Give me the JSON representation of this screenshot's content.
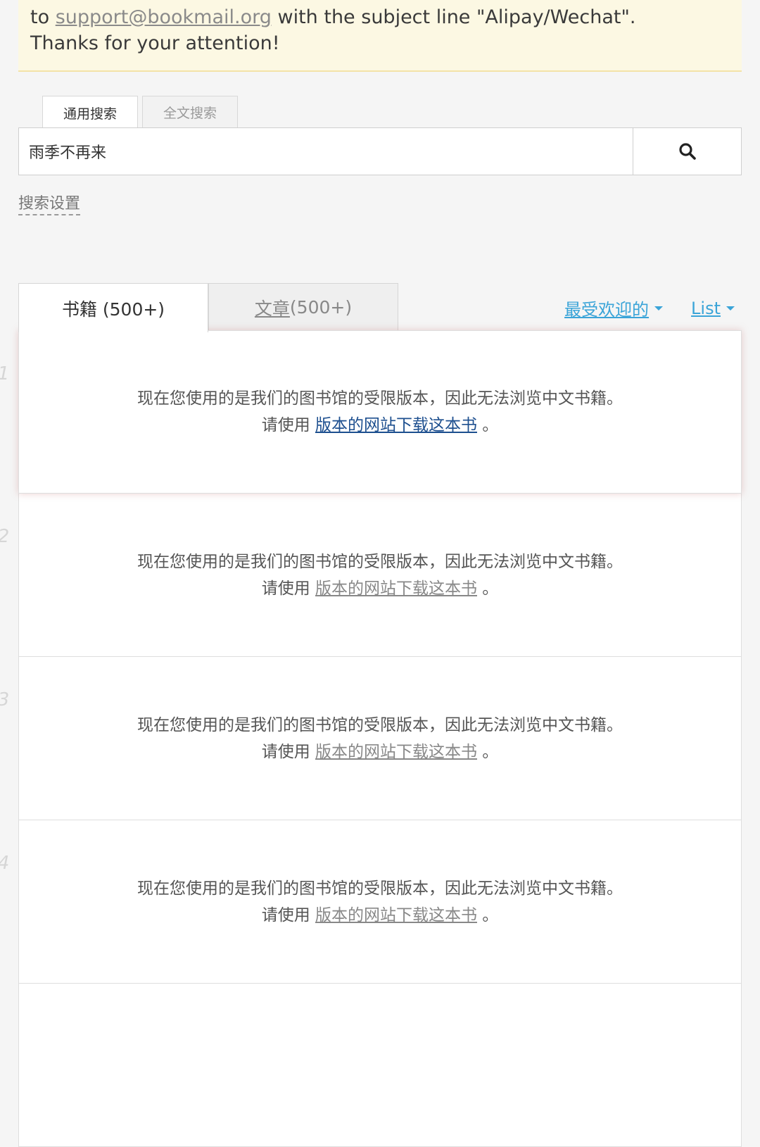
{
  "notice": {
    "line1_prefix": "to ",
    "email": "support@bookmail.org",
    "line1_suffix": " with the subject line \"Alipay/Wechat\".",
    "line2": "Thanks for your attention!"
  },
  "search": {
    "tabs": [
      {
        "label": "通用搜索",
        "active": true
      },
      {
        "label": "全文搜索",
        "active": false
      }
    ],
    "query": "雨季不再来",
    "icon": "search-icon",
    "settings_label": "搜索设置"
  },
  "results_tabs": {
    "tabs": [
      {
        "label": "书籍 (500+)",
        "active": true
      },
      {
        "label_underlined": "文章",
        "label_rest": " (500+)",
        "active": false
      }
    ],
    "sort_label": "最受欢迎的",
    "view_label": "List"
  },
  "results": [
    {
      "num": "1",
      "line1": "现在您使用的是我们的图书馆的受限版本，因此无法浏览中文书籍。",
      "line2_prefix": "请使用 ",
      "link": "版本的网站下载这本书",
      "line2_suffix": " 。"
    },
    {
      "num": "2",
      "line1": "现在您使用的是我们的图书馆的受限版本，因此无法浏览中文书籍。",
      "line2_prefix": "请使用 ",
      "link": "版本的网站下载这本书",
      "line2_suffix": " 。"
    },
    {
      "num": "3",
      "line1": "现在您使用的是我们的图书馆的受限版本，因此无法浏览中文书籍。",
      "line2_prefix": "请使用 ",
      "link": "版本的网站下载这本书",
      "line2_suffix": " 。"
    },
    {
      "num": "4",
      "line1": "现在您使用的是我们的图书馆的受限版本，因此无法浏览中文书籍。",
      "line2_prefix": "请使用 ",
      "link": "版本的网站下载这本书",
      "line2_suffix": " 。"
    },
    {
      "num": "",
      "line1": "",
      "line2_prefix": "",
      "link": "",
      "line2_suffix": ""
    }
  ],
  "colors": {
    "notice_bg": "#fcf8e3",
    "link_blue": "#3aa4d8",
    "link_dark_blue": "#1d4f8f"
  }
}
